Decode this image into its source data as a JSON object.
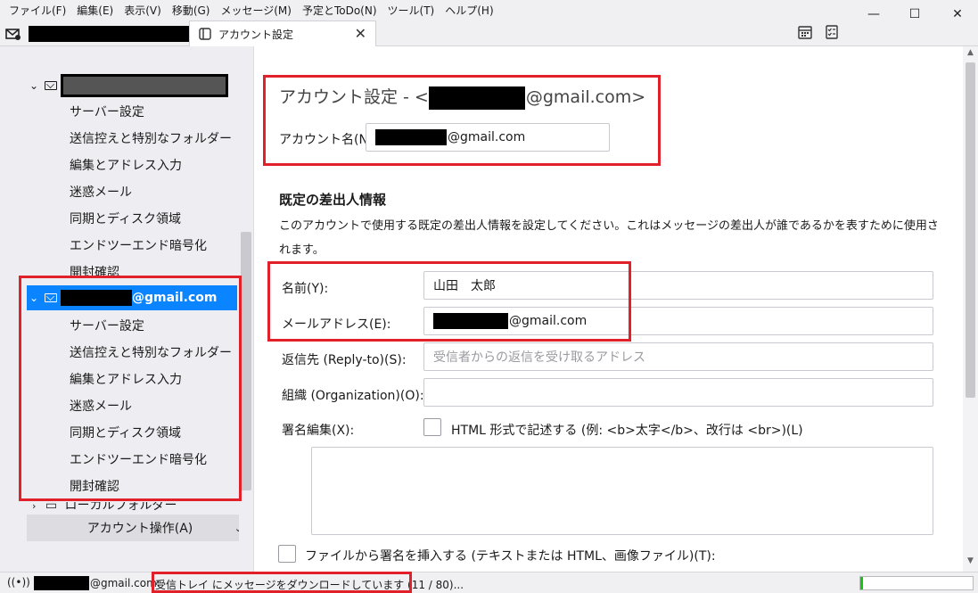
{
  "menu": {
    "items": [
      "ファイル(F)",
      "編集(E)",
      "表示(V)",
      "移動(G)",
      "メッセージ(M)",
      "予定とToDo(N)",
      "ツール(T)",
      "ヘルプ(H)"
    ]
  },
  "window_controls": {
    "minimize": "—",
    "maximize": "☐",
    "close": "✕"
  },
  "tabs": {
    "mail_icon": "mail-icon",
    "settings_label": "アカウント設定",
    "settings_close": "✕"
  },
  "sidebar": {
    "account1": {
      "items": [
        "サーバー設定",
        "送信控えと特別なフォルダー",
        "編集とアドレス入力",
        "迷惑メール",
        "同期とディスク領域",
        "エンドツーエンド暗号化",
        "開封確認"
      ]
    },
    "account2": {
      "email_suffix": "@gmail.com",
      "items": [
        "サーバー設定",
        "送信控えと特別なフォルダー",
        "編集とアドレス入力",
        "迷惑メール",
        "同期とディスク領域",
        "エンドツーエンド暗号化",
        "開封確認"
      ]
    },
    "local_folders_label": "ローカルフォルダー",
    "account_actions_label": "アカウント操作(A)"
  },
  "main": {
    "title_prefix": "アカウント設定 - <",
    "title_suffix": "@gmail.com>",
    "account_name_label": "アカウント名(N):",
    "account_name_suffix": "@gmail.com",
    "identity_heading": "既定の差出人情報",
    "identity_desc": "このアカウントで使用する既定の差出人情報を設定してください。これはメッセージの差出人が誰であるかを表すために使用されます。",
    "name_label": "名前(Y):",
    "name_value": "山田　太郎",
    "email_label": "メールアドレス(E):",
    "email_suffix": "@gmail.com",
    "replyto_label": "返信先 (Reply-to)(S):",
    "replyto_placeholder": "受信者からの返信を受け取るアドレス",
    "org_label": "組織 (Organization)(O):",
    "sig_label": "署名編集(X):",
    "html_checkbox_label": "HTML 形式で記述する (例: <b>太字</b>、改行は <br>)(L)",
    "sig_file_label": "ファイルから署名を挿入する (テキストまたは HTML、画像ファイル)(T):"
  },
  "status": {
    "email_suffix": "@gmail.com:",
    "message": "受信トレイ にメッセージをダウンロードしています (11 / 80)...",
    "progress_fraction": 0.02,
    "progress_color": "#16c60c"
  },
  "colors": {
    "selection": "#0a84ff",
    "highlight_box": "#e2202a",
    "redaction": "#000000"
  }
}
